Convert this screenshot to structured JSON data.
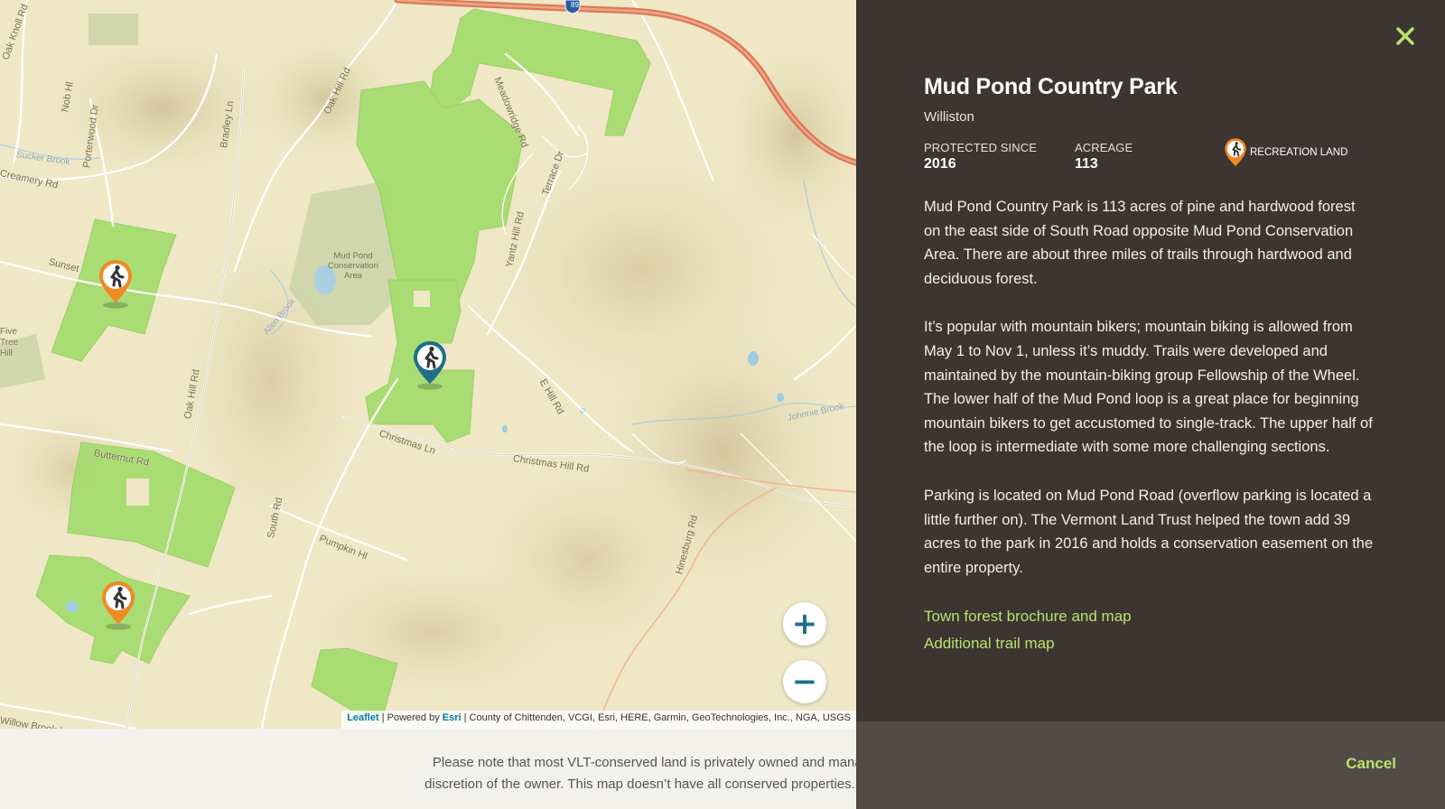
{
  "map": {
    "place_labels": [
      {
        "id": "oak-knoll-rd",
        "text": "Oak Knoll Rd"
      },
      {
        "id": "nob-hl",
        "text": "Nob Hl"
      },
      {
        "id": "porterwood-dr",
        "text": "Porterwood Dr"
      },
      {
        "id": "sucker-brook",
        "text": "Sucker Brook"
      },
      {
        "id": "creamery-rd",
        "text": "Creamery Rd"
      },
      {
        "id": "bradley-ln",
        "text": "Bradley Ln"
      },
      {
        "id": "oak-hill-rd-n",
        "text": "Oak Hill Rd"
      },
      {
        "id": "meadowridge-rd",
        "text": "Meadowridge Rd"
      },
      {
        "id": "terrace-dr",
        "text": "Terrace Dr"
      },
      {
        "id": "yantz-hill-rd",
        "text": "Yantz Hill Rd"
      },
      {
        "id": "sunset",
        "text": "Sunset"
      },
      {
        "id": "allen-brook",
        "text": "Allen Brook"
      },
      {
        "id": "five-tree-hill",
        "text": "Five Tree Hill"
      },
      {
        "id": "oak-hill-rd-s",
        "text": "Oak Hill Rd"
      },
      {
        "id": "e-hill-rd",
        "text": "E Hill Rd"
      },
      {
        "id": "christmas-ln",
        "text": "Christmas Ln"
      },
      {
        "id": "christmas-hill-rd",
        "text": "Christmas Hill Rd"
      },
      {
        "id": "johnnie-brook",
        "text": "Johnnie Brook"
      },
      {
        "id": "butternut-rd",
        "text": "Butternut Rd"
      },
      {
        "id": "south-rd",
        "text": "South Rd"
      },
      {
        "id": "pumpkin-hl",
        "text": "Pumpkin Hl"
      },
      {
        "id": "hinesburg-rd",
        "text": "Hinesburg Rd"
      },
      {
        "id": "willow-brook-ln",
        "text": "Willow Brook Ln"
      }
    ],
    "conservation_label": "Mud Pond\nConservation\nArea",
    "highway_shield": "89",
    "markers": [
      {
        "id": "rec-1",
        "kind": "recreation",
        "color": "#f08a24"
      },
      {
        "id": "selected",
        "kind": "selected",
        "color": "#1f6f8b"
      },
      {
        "id": "rec-2",
        "kind": "recreation",
        "color": "#f08a24"
      }
    ],
    "zoom_in_symbol": "+",
    "zoom_out_symbol": "−",
    "attribution": {
      "leaflet": "Leaflet",
      "separator1": " | Powered by ",
      "esri": "Esri",
      "rest": " | County of Chittenden, VCGI, Esri, HERE, Garmin, GeoTechnologies, Inc., NGA, USGS"
    }
  },
  "footer_note": {
    "line1": "Please note that most VLT-conserved land is privately owned and manag",
    "line2": "discretion of the owner. This map doesn’t have all conserved properties. Mo"
  },
  "panel": {
    "title": "Mud Pond Country Park",
    "town": "Williston",
    "protected_label": "PROTECTED SINCE",
    "protected_value": "2016",
    "acreage_label": "ACREAGE",
    "acreage_value": "113",
    "badge_label": "RECREATION LAND",
    "badge_icon": "hiker-pin-icon",
    "paragraphs": [
      "Mud Pond Country Park is 113 acres of pine and hardwood forest on the east side of South Road opposite Mud Pond Conservation Area. There are about three miles of trails through hardwood and deciduous forest.",
      "It’s popular with mountain bikers; mountain biking is allowed from May 1 to Nov 1, unless it’s muddy. Trails were developed and maintained by the mountain-biking group Fellowship of the Wheel. The lower half of the Mud Pond loop is a great place for beginning mountain bikers to get accustomed to single-track. The upper half of the loop is intermediate with some more challenging sections.",
      "Parking is located on Mud Pond Road (overflow parking is located a little further on). The Vermont Land Trust helped the town add 39 acres to the park in 2016 and holds a conservation easement on the entire property."
    ],
    "links": [
      {
        "label": "Town forest brochure and map"
      },
      {
        "label": "Additional trail map"
      }
    ],
    "cancel_label": "Cancel",
    "colors": {
      "panel_bg": "#3d3531",
      "footer_bg": "#534b46",
      "accent_green": "#b7e26e",
      "recreation_orange": "#f08a24",
      "selected_teal": "#1f6f8b"
    }
  }
}
